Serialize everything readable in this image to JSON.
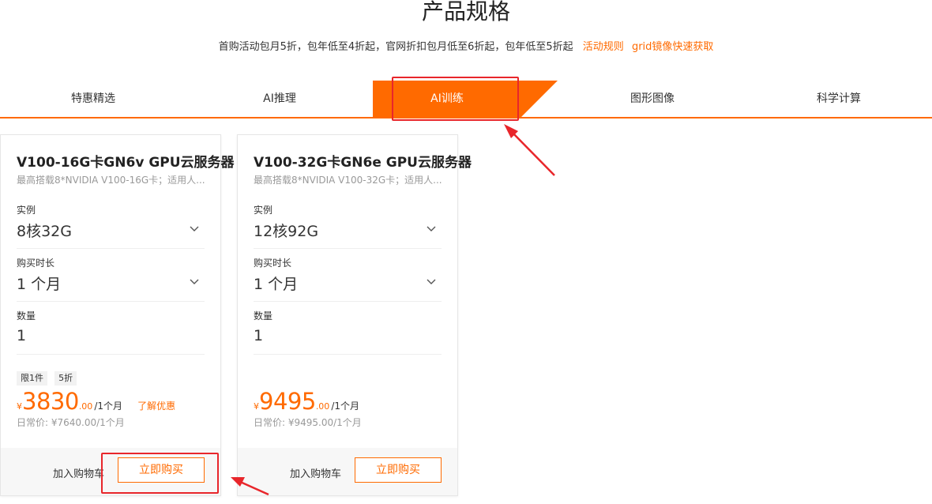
{
  "header": {
    "title": "产品规格",
    "promo_text": "首购活动包月5折，包年低至4折起，官网折扣包月低至6折起，包年低至5折起",
    "links": [
      "活动规则",
      "grid镜像快速获取"
    ]
  },
  "tabs": [
    "特惠精选",
    "AI推理",
    "AI训练",
    "图形图像",
    "科学计算"
  ],
  "active_tab": "AI训练",
  "cards": [
    {
      "title": "V100-16G卡GN6v GPU云服务器",
      "desc": "最高搭载8*NVIDIA V100-16G卡；适用人...",
      "instance_label": "实例",
      "instance_value": "8核32G",
      "duration_label": "购买时长",
      "duration_value": "1 个月",
      "qty_label": "数量",
      "qty_value": "1",
      "badges": [
        "限1件",
        "5折"
      ],
      "currency": "¥",
      "price_int": "3830",
      "price_dec": ".00",
      "price_unit": "/1个月",
      "promo_link": "了解优惠",
      "orig_price": "日常价: ¥7640.00/1个月",
      "cart_label": "加入购物车",
      "buy_label": "立即购买"
    },
    {
      "title": "V100-32G卡GN6e GPU云服务器",
      "desc": "最高搭载8*NVIDIA V100-32G卡；适用人...",
      "instance_label": "实例",
      "instance_value": "12核92G",
      "duration_label": "购买时长",
      "duration_value": "1 个月",
      "qty_label": "数量",
      "qty_value": "1",
      "currency": "¥",
      "price_int": "9495",
      "price_dec": ".00",
      "price_unit": "/1个月",
      "orig_price": "日常价: ¥9495.00/1个月",
      "cart_label": "加入购物车",
      "buy_label": "立即购买"
    }
  ],
  "colors": {
    "accent": "#ff6a00",
    "highlight": "#e8262b"
  }
}
